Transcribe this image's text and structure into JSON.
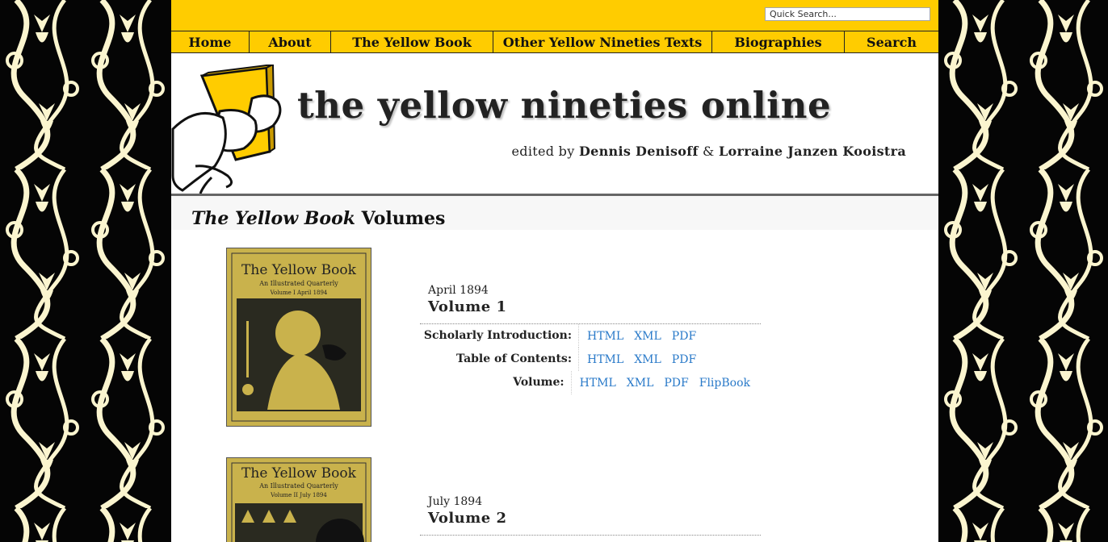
{
  "search": {
    "placeholder": "Quick Search..."
  },
  "nav": [
    {
      "label": "Home"
    },
    {
      "label": "About"
    },
    {
      "label": "The Yellow Book"
    },
    {
      "label": "Other Yellow Nineties Texts"
    },
    {
      "label": "Biographies"
    },
    {
      "label": "Search"
    }
  ],
  "masthead": {
    "title": "the yellow nineties online",
    "editors_prefix": "edited by",
    "editor1": "Dennis Denisoff",
    "amp": "&",
    "editor2": "Lorraine Janzen Kooistra"
  },
  "section": {
    "title_italic": "The Yellow Book",
    "title_rest": "Volumes"
  },
  "volumes": [
    {
      "date": "April 1894",
      "title": "Volume 1",
      "cover_title": "The Yellow Book",
      "cover_subtitle": "An Illustrated Quarterly",
      "cover_volume": "Volume I April 1894",
      "rows": [
        {
          "label": "Scholarly Introduction:",
          "links": [
            "HTML",
            "XML",
            "PDF"
          ]
        },
        {
          "label": "Table of Contents:",
          "links": [
            "HTML",
            "XML",
            "PDF"
          ]
        },
        {
          "label": "Volume:",
          "links": [
            "HTML",
            "XML",
            "PDF",
            "FlipBook"
          ]
        }
      ]
    },
    {
      "date": "July 1894",
      "title": "Volume 2",
      "cover_title": "The Yellow Book",
      "cover_subtitle": "An Illustrated Quarterly",
      "cover_volume": "Volume II July 1894"
    }
  ],
  "colors": {
    "yellow": "#ffcc00",
    "link": "#2a7ac9",
    "pattern_cream": "#fbf5cf"
  }
}
